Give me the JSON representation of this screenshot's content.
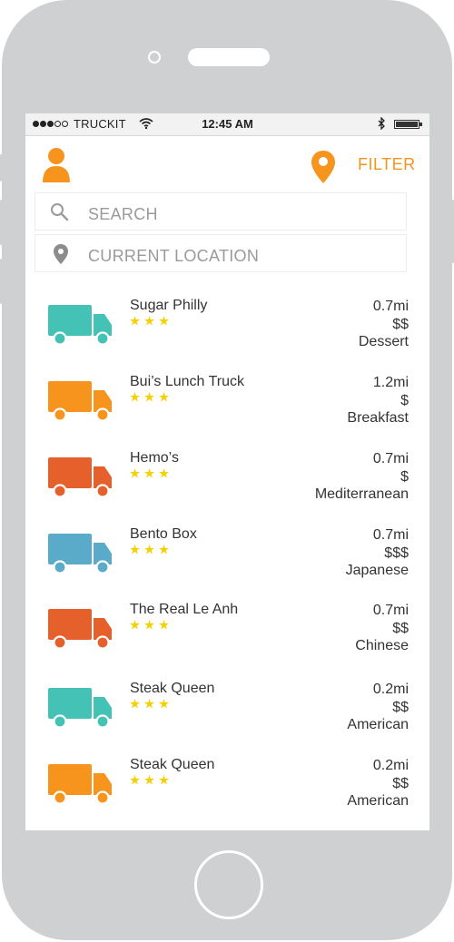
{
  "status_bar": {
    "carrier": "TRUCKIT",
    "time": "12:45 AM",
    "signal_bars": 3,
    "signal_total": 5,
    "bluetooth_icon": "bluetooth-icon",
    "battery_level": 1.0
  },
  "header": {
    "profile_icon": "user-icon",
    "location_icon": "map-pin-icon",
    "filter_label": "FILTER",
    "accent_color": "#f7941d"
  },
  "search": {
    "placeholder": "SEARCH",
    "icon": "search-icon"
  },
  "location": {
    "placeholder": "CURRENT LOCATION",
    "icon": "location-pin-icon"
  },
  "trucks": [
    {
      "name": "Sugar Philly",
      "rating": 3,
      "distance": "0.7mi",
      "price": "$$",
      "cuisine": "Dessert",
      "color": "#44c2b5"
    },
    {
      "name": "Bui’s Lunch Truck",
      "rating": 3,
      "distance": "1.2mi",
      "price": "$",
      "cuisine": "Breakfast",
      "color": "#f7941d"
    },
    {
      "name": "Hemo’s",
      "rating": 3,
      "distance": "0.7mi",
      "price": "$",
      "cuisine": "Mediterranean",
      "color": "#e5602b"
    },
    {
      "name": "Bento Box",
      "rating": 3,
      "distance": "0.7mi",
      "price": "$$$",
      "cuisine": "Japanese",
      "color": "#5aabc9"
    },
    {
      "name": "The Real Le Anh",
      "rating": 3,
      "distance": "0.7mi",
      "price": "$$",
      "cuisine": "Chinese",
      "color": "#e5602b"
    },
    {
      "name": "Steak Queen",
      "rating": 3,
      "distance": "0.2mi",
      "price": "$$",
      "cuisine": "American",
      "color": "#44c2b5"
    },
    {
      "name": "Steak Queen",
      "rating": 3,
      "distance": "0.2mi",
      "price": "$$",
      "cuisine": "American",
      "color": "#f7941d"
    }
  ],
  "colors": {
    "star": "#f5d000",
    "device_frame": "#cfd0d1"
  }
}
